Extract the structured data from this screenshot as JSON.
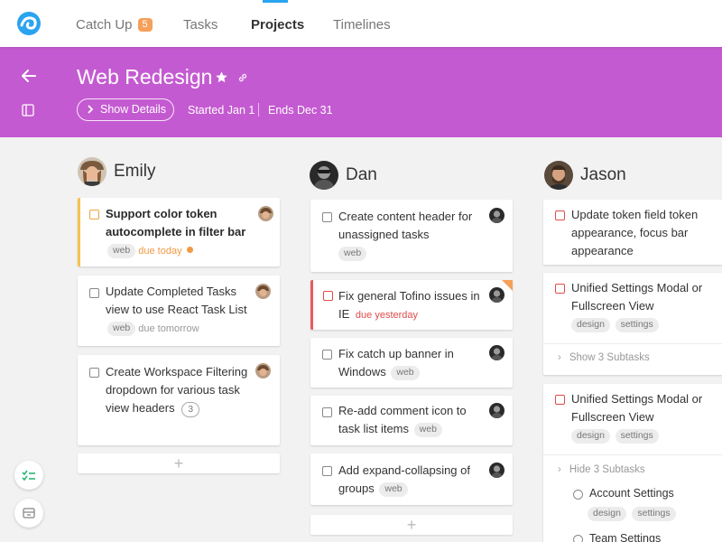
{
  "nav": {
    "items": [
      {
        "label": "Catch Up",
        "badge": "5"
      },
      {
        "label": "Tasks"
      },
      {
        "label": "Projects"
      },
      {
        "label": "Timelines"
      }
    ],
    "active": "Projects"
  },
  "project": {
    "title": "Web Redesign",
    "details_label": "Show Details",
    "started": "Started Jan 1",
    "ends": "Ends Dec 31",
    "color": "#c45ad1"
  },
  "columns": [
    {
      "name": "Emily",
      "cards": [
        {
          "title": "Support color token autocomplete in filter bar",
          "tag": "web",
          "due": "due today"
        },
        {
          "title": "Update Completed Tasks view to use React Task List",
          "tag": "web",
          "due": "due tomorrow"
        },
        {
          "title": "Create Workspace Filtering dropdown for various task view headers",
          "comments": "3"
        }
      ]
    },
    {
      "name": "Dan",
      "cards": [
        {
          "title": "Create content header for unassigned tasks",
          "tag": "web"
        },
        {
          "title": "Fix general Tofino issues in IE",
          "due": "due yesterday"
        },
        {
          "title": "Fix catch up banner in Windows",
          "tag": "web"
        },
        {
          "title": "Re-add comment icon to task list items",
          "tag": "web"
        },
        {
          "title": "Add expand-collapsing of groups",
          "tag": "web"
        }
      ]
    },
    {
      "name": "Jason",
      "cards": [
        {
          "title": "Update token field token appearance, focus bar appearance"
        },
        {
          "title": "Unified Settings Modal or Fullscreen View",
          "tags": [
            "design",
            "settings"
          ],
          "subtasks_toggle": "Show 3 Subtasks"
        },
        {
          "title": "Unified Settings Modal or Fullscreen View",
          "tags": [
            "design",
            "settings"
          ],
          "subtasks_toggle": "Hide 3 Subtasks",
          "subtasks": [
            {
              "title": "Account Settings",
              "tags": [
                "design",
                "settings"
              ]
            },
            {
              "title": "Team Settings"
            }
          ]
        }
      ]
    }
  ],
  "icons": {
    "logo": "app-logo",
    "back": "arrow-left-icon",
    "panel": "sidebar-toggle-icon",
    "star": "star-icon",
    "link": "link-icon",
    "fab1": "checklist-icon",
    "fab2": "archive-box-icon"
  }
}
